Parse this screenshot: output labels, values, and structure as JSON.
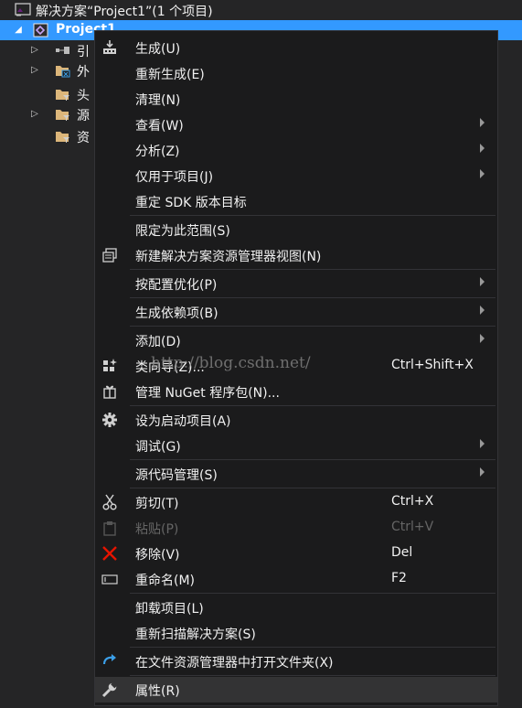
{
  "tree": {
    "solution_label": "解决方案“Project1”(1 个项目)",
    "project_label": "Project1",
    "children": [
      "引",
      "外",
      "头",
      "源",
      "资"
    ]
  },
  "menu": [
    {
      "label": "生成(U)",
      "icon": "build-icon"
    },
    {
      "label": "重新生成(E)"
    },
    {
      "label": "清理(N)"
    },
    {
      "label": "查看(W)",
      "submenu": true
    },
    {
      "label": "分析(Z)",
      "submenu": true
    },
    {
      "label": "仅用于项目(J)",
      "submenu": true
    },
    {
      "label": "重定 SDK 版本目标"
    },
    {
      "label": "限定为此范围(S)"
    },
    {
      "label": "新建解决方案资源管理器视图(N)",
      "icon": "new-view-icon"
    },
    {
      "label": "按配置优化(P)",
      "submenu": true
    },
    {
      "label": "生成依赖项(B)",
      "submenu": true
    },
    {
      "label": "添加(D)",
      "submenu": true
    },
    {
      "label": "类向导(Z)...",
      "shortcut": "Ctrl+Shift+X",
      "icon": "class-wizard-icon"
    },
    {
      "label": "管理 NuGet 程序包(N)...",
      "icon": "nuget-icon"
    },
    {
      "label": "设为启动项目(A)",
      "icon": "gear-icon"
    },
    {
      "label": "调试(G)",
      "submenu": true
    },
    {
      "label": "源代码管理(S)",
      "submenu": true
    },
    {
      "label": "剪切(T)",
      "shortcut": "Ctrl+X",
      "icon": "scissors-icon"
    },
    {
      "label": "粘贴(P)",
      "shortcut": "Ctrl+V",
      "icon": "paste-icon",
      "disabled": true
    },
    {
      "label": "移除(V)",
      "shortcut": "Del",
      "icon": "remove-icon"
    },
    {
      "label": "重命名(M)",
      "shortcut": "F2",
      "icon": "rename-icon"
    },
    {
      "label": "卸载项目(L)"
    },
    {
      "label": "重新扫描解决方案(S)"
    },
    {
      "label": "在文件资源管理器中打开文件夹(X)",
      "icon": "open-folder-arrow-icon"
    },
    {
      "label": "属性(R)",
      "icon": "wrench-icon",
      "highlighted": true
    }
  ],
  "watermark": "http://blog.csdn.net/",
  "colors": {
    "selection": "#3399ff",
    "menu_bg": "#1b1b1c",
    "remove_red": "#e51400",
    "accent_blue": "#3b9fe8"
  }
}
